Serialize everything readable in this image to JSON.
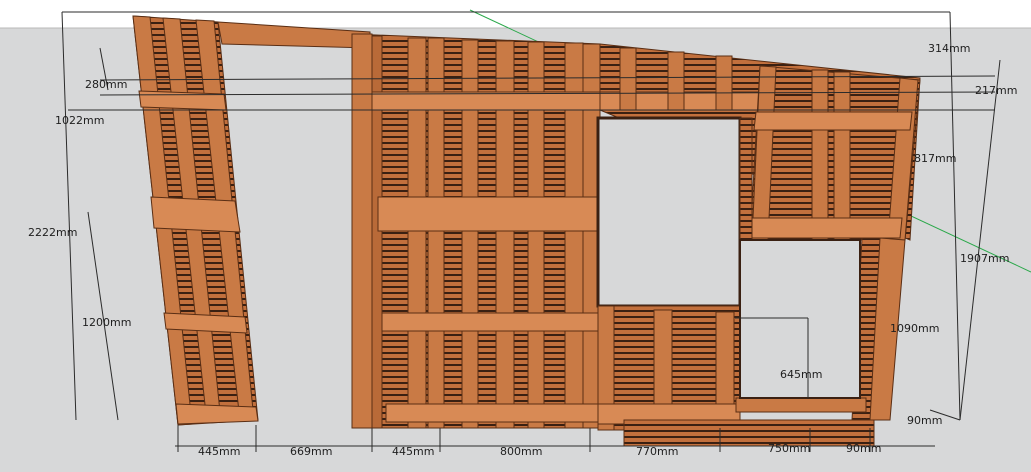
{
  "colors": {
    "sky": "#ffffff",
    "ground": "#d7d8d9",
    "wood": "#c2703d",
    "wood_light": "#d88a55",
    "wood_dark": "#8e4a22",
    "plank_gap": "#3a2012",
    "dim_line": "#2b2b2b",
    "axis_green": "#2aa84a"
  },
  "dimensions": {
    "total_height": "2222mm",
    "top_280": "280mm",
    "h_1022": "1022mm",
    "h_1200": "1200mm",
    "w_445_left": "445mm",
    "w_669": "669mm",
    "w_445_mid": "445mm",
    "w_800": "800mm",
    "w_770": "770mm",
    "w_750": "750mm",
    "w_90_bottom": "90mm",
    "right_314": "314mm",
    "right_217": "217mm",
    "right_817": "817mm",
    "right_1907": "1907mm",
    "right_1090": "1090mm",
    "opening_645": "645mm",
    "right_90": "90mm"
  }
}
